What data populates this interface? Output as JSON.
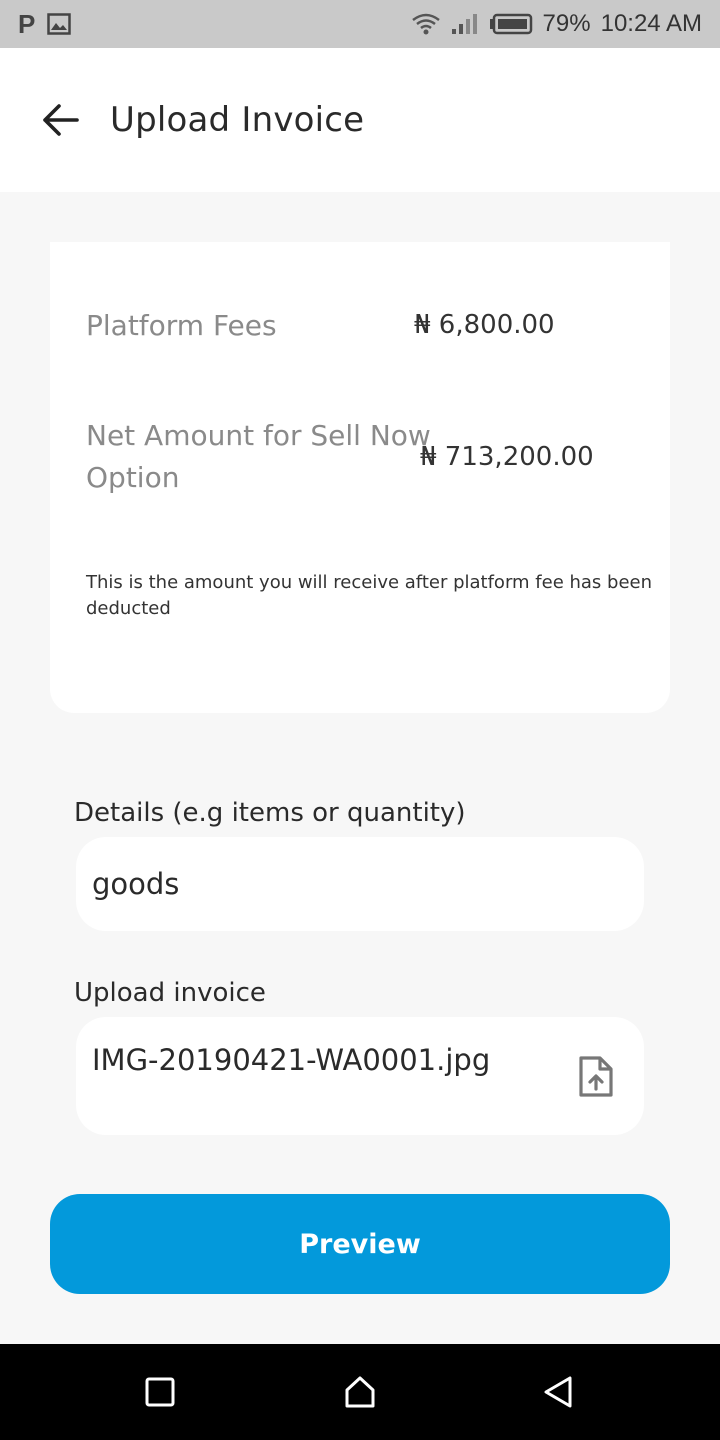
{
  "status_bar": {
    "battery": "79%",
    "time": "10:24 AM",
    "icons": [
      "p-icon",
      "image-icon",
      "wifi-icon",
      "signal-icon",
      "battery-icon"
    ]
  },
  "header": {
    "title": "Upload Invoice",
    "back_icon": "arrow-left-icon"
  },
  "summary": {
    "platform_fees_label": "Platform Fees",
    "platform_fees_value": "₦ 6,800.00",
    "net_amount_label": "Net Amount for Sell Now Option",
    "net_amount_value": "₦ 713,200.00",
    "note": "This is the amount you will receive after platform fee has been deducted"
  },
  "form": {
    "details_label": "Details (e.g items or quantity)",
    "details_value": "goods",
    "upload_label": "Upload invoice",
    "upload_value": "IMG-20190421-WA0001.jpg",
    "upload_icon": "file-upload-icon"
  },
  "actions": {
    "preview_label": "Preview",
    "accent_color": "#0399db"
  },
  "nav_bar": {
    "icons": [
      "recent-apps-icon",
      "home-icon",
      "back-triangle-icon"
    ]
  }
}
